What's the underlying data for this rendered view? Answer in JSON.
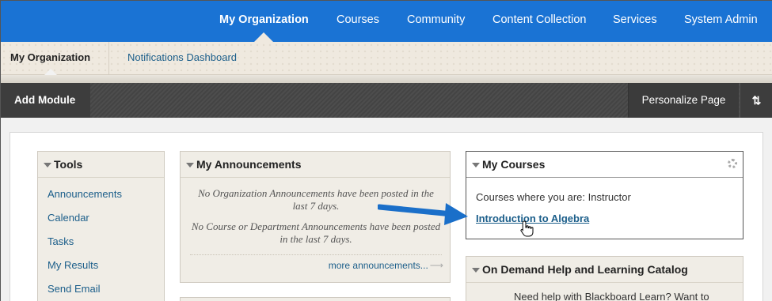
{
  "topnav": {
    "tabs": [
      {
        "label": "My Organization",
        "active": true
      },
      {
        "label": "Courses"
      },
      {
        "label": "Community"
      },
      {
        "label": "Content Collection"
      },
      {
        "label": "Services"
      },
      {
        "label": "System Admin"
      }
    ]
  },
  "subnav": {
    "current": "My Organization",
    "link": "Notifications Dashboard"
  },
  "actionbar": {
    "add_module": "Add Module",
    "personalize": "Personalize Page",
    "sort_icon": "⇅"
  },
  "tools": {
    "title": "Tools",
    "links": [
      "Announcements",
      "Calendar",
      "Tasks",
      "My Results",
      "Send Email"
    ]
  },
  "announcements": {
    "title": "My Announcements",
    "msg1": "No Organization Announcements have been posted in the last 7 days.",
    "msg2": "No Course or Department Announcements have been posted in the last 7 days.",
    "more": "more announcements...",
    "more_arrow": "⟶"
  },
  "courses": {
    "title": "My Courses",
    "role_text": "Courses where you are: Instructor",
    "course_link": "Introduction to Algebra"
  },
  "help": {
    "title": "On Demand Help and Learning Catalog",
    "body": "Need help with Blackboard Learn? Want to"
  },
  "colors": {
    "topnav_bg": "#1a73d4",
    "link": "#1b5e8a",
    "arrow": "#1a6fc9"
  }
}
